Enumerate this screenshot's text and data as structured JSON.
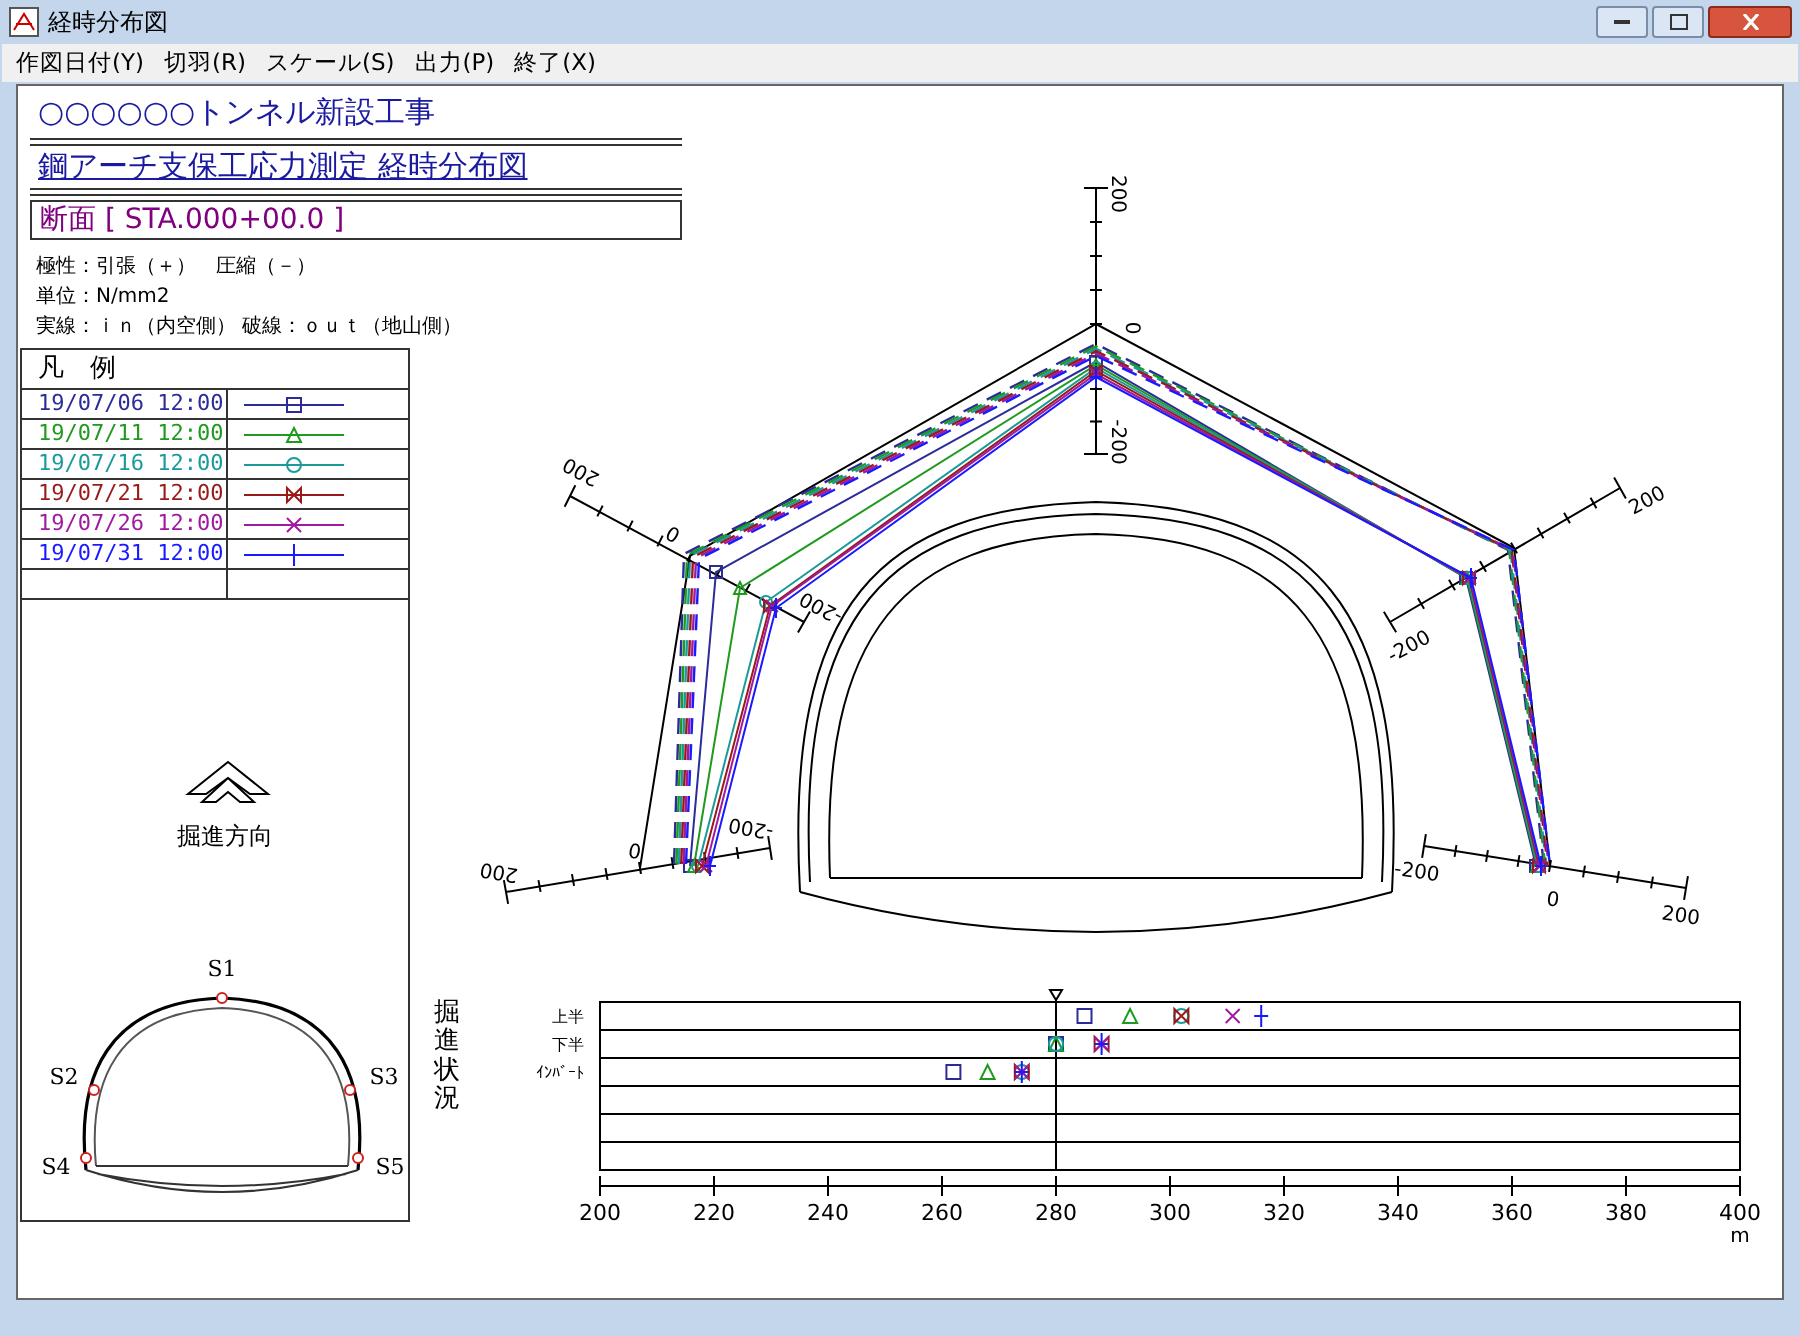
{
  "window": {
    "title": "経時分布図"
  },
  "menu": [
    "作図日付(Y)",
    "切羽(R)",
    "スケール(S)",
    "出力(P)",
    "終了(X)"
  ],
  "header": {
    "project": "○○○○○○トンネル新設工事",
    "title": "鋼アーチ支保工応力測定 経時分布図",
    "section": "断面 [ STA.000+00.0 ]",
    "notes": [
      "極性：引張（＋）　圧縮（－）",
      "単位：N/mm2",
      "実線：ｉｎ（内空側） 破線：ｏｕｔ（地山側）"
    ]
  },
  "legend": {
    "title": "凡　例",
    "entries": [
      {
        "date": "19/07/06 12:00",
        "color": "#2b2b9a",
        "kind": "square"
      },
      {
        "date": "19/07/11 12:00",
        "color": "#1f9a1f",
        "kind": "triangle"
      },
      {
        "date": "19/07/16 12:00",
        "color": "#1a9a9a",
        "kind": "circle"
      },
      {
        "date": "19/07/21 12:00",
        "color": "#9a1a1a",
        "kind": "bowtie"
      },
      {
        "date": "19/07/26 12:00",
        "color": "#a01aa0",
        "kind": "cross"
      },
      {
        "date": "19/07/31 12:00",
        "color": "#1a1aff",
        "kind": "plus"
      }
    ]
  },
  "direction": {
    "label": "掘進方向"
  },
  "key_plan": {
    "points": [
      "S1",
      "S2",
      "S3",
      "S4",
      "S5"
    ]
  },
  "stress_diagram": {
    "axes": [
      {
        "plus": "200",
        "zero": "0",
        "minus": "-200"
      },
      {
        "plus": "200",
        "zero": "0",
        "minus": "-200"
      },
      {
        "plus": "200",
        "minus": "-200"
      },
      {
        "plus": "200",
        "zero": "0",
        "minus": "-200"
      },
      {
        "plus": "200",
        "zero": "0",
        "minus": "-200"
      }
    ]
  },
  "progress": {
    "label": "掘進状況",
    "rows": [
      "上半",
      "下半",
      "ｲﾝﾊﾞｰﾄ"
    ],
    "ticks": [
      "200",
      "220",
      "240",
      "260",
      "280",
      "300",
      "320",
      "340",
      "360",
      "380",
      "400"
    ],
    "unit": "m"
  }
}
